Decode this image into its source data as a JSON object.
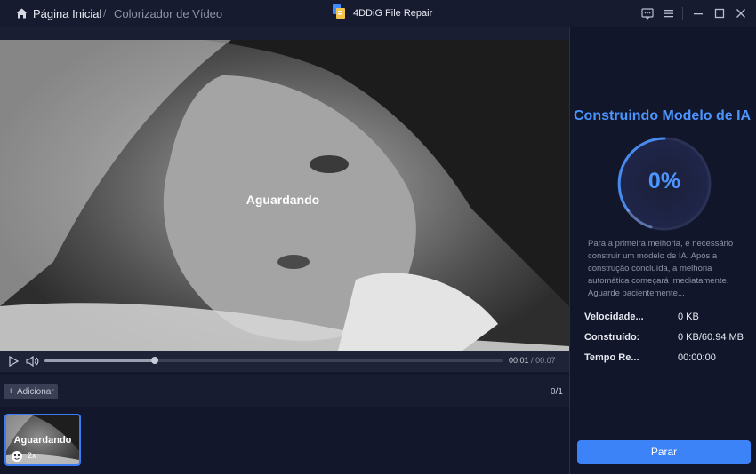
{
  "titlebar": {
    "home_label": "Página Inicial",
    "separator": "/",
    "current_page": "Colorizador de Vídeo",
    "app_name": "4DDiG File Repair",
    "icons": [
      "home-icon",
      "app-logo-icon",
      "feedback-icon",
      "menu-icon",
      "minimize-icon",
      "maximize-icon",
      "close-icon"
    ]
  },
  "video": {
    "status_text": "Aguardando",
    "current_time": "00:01",
    "time_separator": "/",
    "total_time": "00:07",
    "progress_fraction": 0.24
  },
  "queue": {
    "add_label": "Adicionar",
    "count": "0/1",
    "items": [
      {
        "status": "Aguardando",
        "scale": "2x"
      }
    ]
  },
  "panel": {
    "title": "Construindo Modelo de IA",
    "percent_text": "0%",
    "description": "Para a primeira melhoria, é necessário construir um modelo de IA. Após a construção concluída, a melhoria automática começará imediatamente. Aguarde pacientemente...",
    "stats": [
      {
        "label": "Velocidade...",
        "value": "0 KB"
      },
      {
        "label": "Construído:",
        "value": "0 KB/60.94 MB"
      },
      {
        "label": "Tempo Re...",
        "value": "00:00:00"
      }
    ],
    "stop_label": "Parar"
  },
  "colors": {
    "accent": "#3b83f6",
    "title_blue": "#4c95ff",
    "background": "#13172b"
  }
}
